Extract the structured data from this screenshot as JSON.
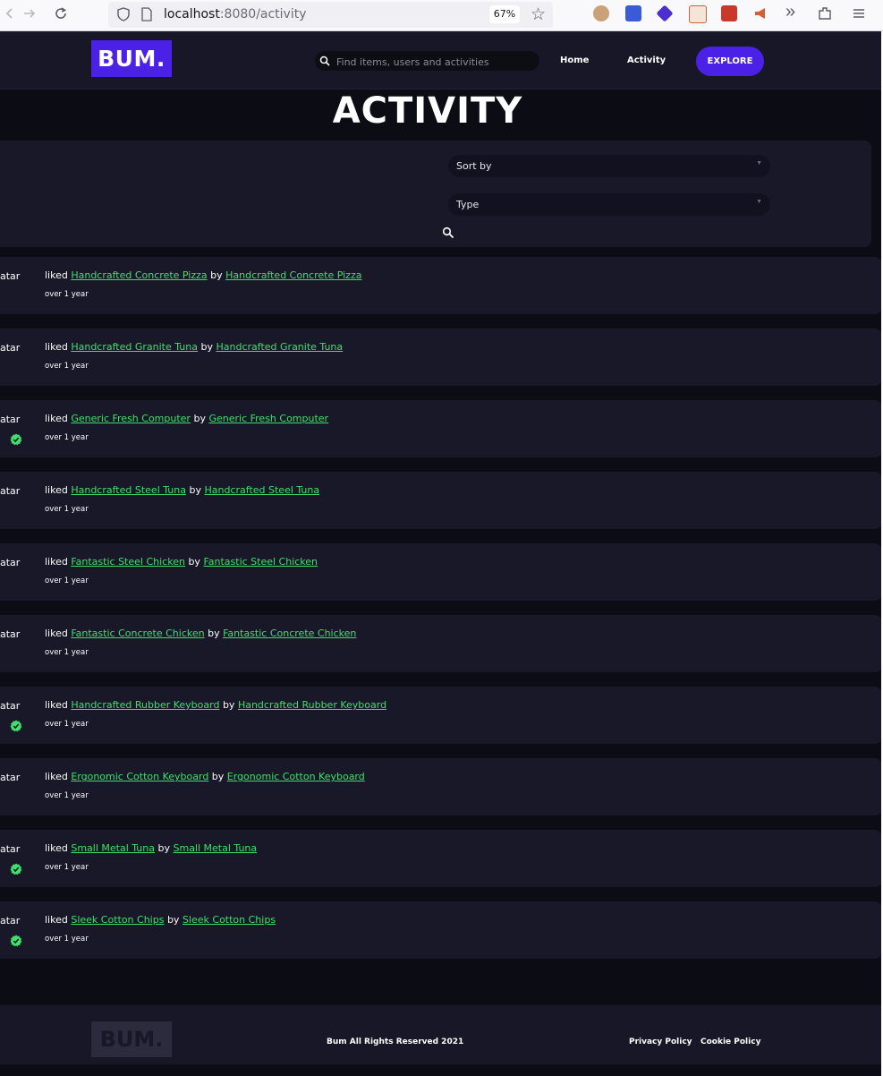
{
  "browser": {
    "url_host": "localhost",
    "url_path": ":8080/activity",
    "zoom": "67%"
  },
  "header": {
    "logo": "BUM.",
    "search_placeholder": "Find items, users and activities",
    "nav": {
      "home": "Home",
      "activity": "Activity"
    },
    "explore": "EXPLORE"
  },
  "page": {
    "title": "ACTIVITY"
  },
  "filters": {
    "sort_label": "Sort by",
    "type_label": "Type"
  },
  "activities": [
    {
      "avatar_alt": "atar",
      "verb": "liked",
      "item": "Handcrafted Concrete Pizza",
      "by": "by",
      "owner": "Handcrafted Concrete Pizza",
      "time": "over 1 year",
      "verified": false
    },
    {
      "avatar_alt": "atar",
      "verb": "liked",
      "item": "Handcrafted Granite Tuna",
      "by": "by",
      "owner": "Handcrafted Granite Tuna",
      "time": "over 1 year",
      "verified": false
    },
    {
      "avatar_alt": "atar",
      "verb": "liked",
      "item": "Generic Fresh Computer",
      "by": "by",
      "owner": "Generic Fresh Computer",
      "time": "over 1 year",
      "verified": true
    },
    {
      "avatar_alt": "atar",
      "verb": "liked",
      "item": "Handcrafted Steel Tuna",
      "by": "by",
      "owner": "Handcrafted Steel Tuna",
      "time": "over 1 year",
      "verified": false
    },
    {
      "avatar_alt": "atar",
      "verb": "liked",
      "item": "Fantastic Steel Chicken",
      "by": "by",
      "owner": "Fantastic Steel Chicken",
      "time": "over 1 year",
      "verified": false
    },
    {
      "avatar_alt": "atar",
      "verb": "liked",
      "item": "Fantastic Concrete Chicken",
      "by": "by",
      "owner": "Fantastic Concrete Chicken",
      "time": "over 1 year",
      "verified": false
    },
    {
      "avatar_alt": "atar",
      "verb": "liked",
      "item": "Handcrafted Rubber Keyboard",
      "by": "by",
      "owner": "Handcrafted Rubber Keyboard",
      "time": "over 1 year",
      "verified": true
    },
    {
      "avatar_alt": "atar",
      "verb": "liked",
      "item": "Ergonomic Cotton Keyboard",
      "by": "by",
      "owner": "Ergonomic Cotton Keyboard",
      "time": "over 1 year",
      "verified": false
    },
    {
      "avatar_alt": "atar",
      "verb": "liked",
      "item": "Small Metal Tuna",
      "by": "by",
      "owner": "Small Metal Tuna",
      "time": "over 1 year",
      "verified": true
    },
    {
      "avatar_alt": "atar",
      "verb": "liked",
      "item": "Sleek Cotton Chips",
      "by": "by",
      "owner": "Sleek Cotton Chips",
      "time": "over 1 year",
      "verified": true
    }
  ],
  "footer": {
    "logo": "BUM.",
    "copyright": "Bum All Rights Reserved 2021",
    "privacy": "Privacy Policy",
    "cookie": "Cookie Policy"
  },
  "colors": {
    "brand": "#4b21e8",
    "link": "#3ee06b",
    "card": "#181828",
    "background": "#0c0c15"
  },
  "icons": [
    "back-arrow-icon",
    "forward-arrow-icon",
    "reload-icon",
    "shield-icon",
    "page-icon",
    "bookmark-star-icon",
    "search-icon",
    "caret-down-icon",
    "verified-badge-icon",
    "overflow-chevrons-icon",
    "extensions-puzzle-icon",
    "hamburger-menu-icon"
  ]
}
